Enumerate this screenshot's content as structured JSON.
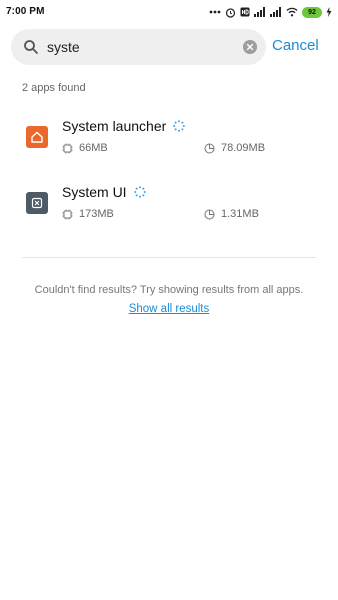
{
  "status_bar": {
    "time": "7:00 PM",
    "battery": "92",
    "icons": [
      "dots-icon",
      "alarm-icon",
      "hd-icon",
      "signal-icon",
      "signal-icon",
      "wifi-icon",
      "battery-icon",
      "charging-icon"
    ]
  },
  "search": {
    "value": "syste",
    "cancel_label": "Cancel"
  },
  "results_count": "2 apps found",
  "apps": [
    {
      "name": "System launcher",
      "memory": "66MB",
      "storage": "78.09MB",
      "icon_color": "#e8692b",
      "icon": "home-icon"
    },
    {
      "name": "System UI",
      "memory": "173MB",
      "storage": "1.31MB",
      "icon_color": "#4f5a66",
      "icon": "system-ui-icon"
    }
  ],
  "footer": {
    "message": "Couldn't find results? Try showing results from all apps.",
    "link_label": "Show all results"
  },
  "colors": {
    "accent": "#1a8cd8"
  }
}
